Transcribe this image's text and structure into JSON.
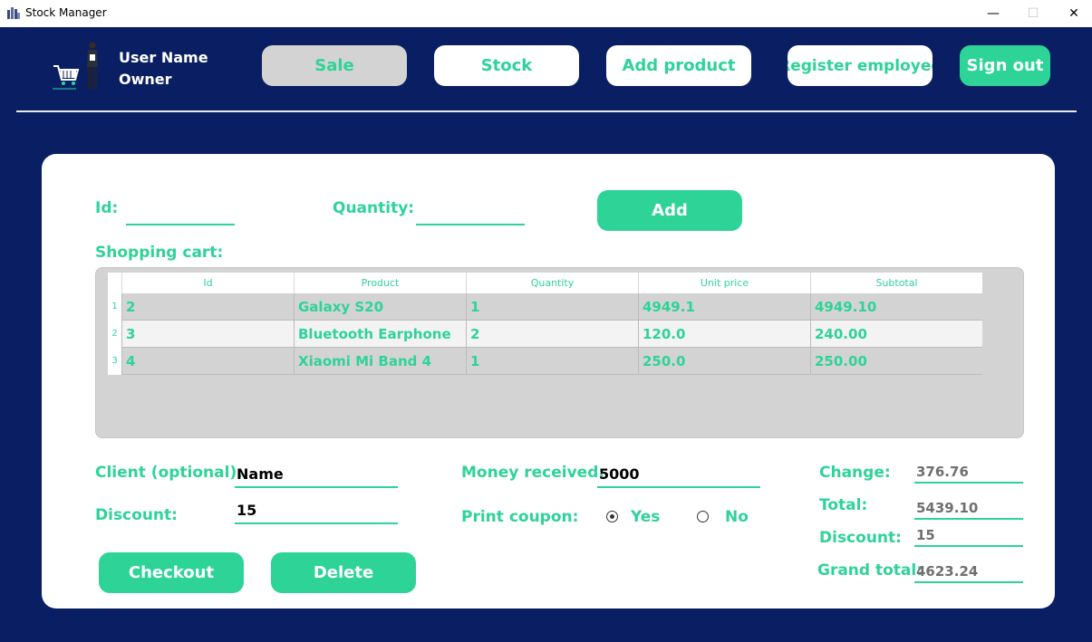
{
  "window": {
    "title": "Stock Manager",
    "minimize": "—",
    "maximize": "☐",
    "close": "✕"
  },
  "user": {
    "name": "User Name",
    "role": "Owner"
  },
  "nav": {
    "sale": "Sale",
    "stock": "Stock",
    "add_product": "Add product",
    "register_employee": "Register employee",
    "sign_out": "Sign out"
  },
  "form": {
    "id_label": "Id:",
    "id_value": "",
    "quantity_label": "Quantity:",
    "quantity_value": "",
    "add_button": "Add"
  },
  "cart": {
    "title": "Shopping cart:",
    "columns": [
      "Id",
      "Product",
      "Quantity",
      "Unit price",
      "Subtotal"
    ],
    "rows": [
      {
        "num": "1",
        "id": "2",
        "product": "Galaxy S20",
        "quantity": "1",
        "unit_price": "4949.1",
        "subtotal": "4949.10"
      },
      {
        "num": "2",
        "id": "3",
        "product": "Bluetooth Earphone",
        "quantity": "2",
        "unit_price": "120.0",
        "subtotal": "240.00"
      },
      {
        "num": "3",
        "id": "4",
        "product": "Xiaomi Mi Band 4",
        "quantity": "1",
        "unit_price": "250.0",
        "subtotal": "250.00"
      }
    ]
  },
  "checkout": {
    "client_label": "Client (optional):",
    "client_value": "Name",
    "discount_label": "Discount:",
    "discount_value": "15",
    "money_label": "Money received:",
    "money_value": "5000",
    "print_label": "Print coupon:",
    "yes": "Yes",
    "no": "No",
    "checkout_button": "Checkout",
    "delete_button": "Delete"
  },
  "summary": {
    "change_label": "Change:",
    "change_value": "376.76",
    "total_label": "Total:",
    "total_value": "5439.10",
    "discount_label": "Discount:",
    "discount_value": "15",
    "grand_label": "Grand total:",
    "grand_value": "4623.24"
  },
  "colors": {
    "navy": "#0a1f63",
    "accent": "#2ed398",
    "gray": "#d3d3d3"
  }
}
